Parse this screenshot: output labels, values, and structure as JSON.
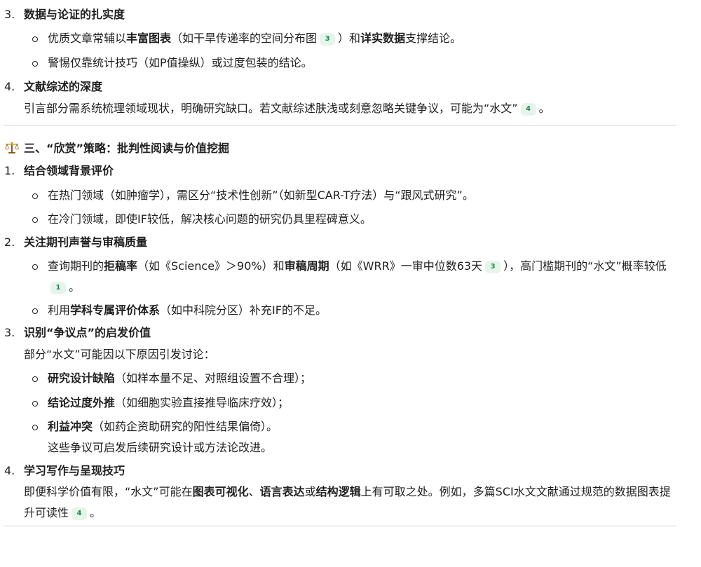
{
  "item3_top": {
    "num": "3.",
    "title": "数据与论证的扎实度",
    "bullets": [
      {
        "t1": "优质文章常辅以",
        "b1": "丰富图表",
        "t2": "（如干旱传递率的空间分布图",
        "cite": "3",
        "t3": "）和",
        "b2": "详实数据",
        "t4": "支撑结论。"
      },
      {
        "t1": "警惕仅靠统计技巧（如P值操纵）或过度包装的结论。"
      }
    ]
  },
  "item4_top": {
    "num": "4.",
    "title": "文献综述的深度",
    "text": "引言部分需系统梳理领域现状，明确研究缺口。若文献综述肤浅或刻意忽略关键争议，可能为“水文”",
    "cite": "4",
    "end": "。"
  },
  "section3": {
    "heading": "三、“欣赏”策略：批判性阅读与价值挖掘",
    "icon": "balance-scale-icon",
    "items": {
      "i1": {
        "num": "1.",
        "title": "结合领域背景评价",
        "b1": "在热门领域（如肿瘤学），需区分“技术性创新”（如新型CAR-T疗法）与“跟风式研究”。",
        "b2": "在冷门领域，即使IF较低，解决核心问题的研究仍具里程碑意义。"
      },
      "i2": {
        "num": "2.",
        "title": "关注期刊声誉与审稿质量",
        "b1_t1": "查询期刊的",
        "b1_b1": "拒稿率",
        "b1_t2": "（如《Science》＞90%）和",
        "b1_b2": "审稿周期",
        "b1_t3": "（如《WRR》一审中位数63天",
        "b1_cite1": "3",
        "b1_t4": "），高门槛期刊的“水文”概率较低",
        "b1_cite2": "1",
        "b1_t5": "。",
        "b2_t1": "利用",
        "b2_b1": "学科专属评价体系",
        "b2_t2": "（如中科院分区）补充IF的不足。"
      },
      "i3": {
        "num": "3.",
        "title": "识别“争议点”的启发价值",
        "intro": "部分“水文”可能因以下原因引发讨论：",
        "bullets": [
          {
            "b": "研究设计缺陷",
            "t": "（如样本量不足、对照组设置不合理）；"
          },
          {
            "b": "结论过度外推",
            "t": "（如细胞实验直接推导临床疗效）；"
          },
          {
            "b": "利益冲突",
            "t": "（如药企资助研究的阳性结果偏倚）。",
            "extra": "这些争议可启发后续研究设计或方法论改进。"
          }
        ]
      },
      "i4": {
        "num": "4.",
        "title": "学习写作与呈现技巧",
        "t1": "即便科学价值有限，“水文”可能在",
        "b1": "图表可视化",
        "t2": "、",
        "b2": "语言表达",
        "t3": "或",
        "b3": "结构逻辑",
        "t4": "上有可取之处。例如，多篇SCI水文文献通过规范的数据图表提升可读性",
        "cite": "4",
        "t5": "。"
      }
    }
  }
}
